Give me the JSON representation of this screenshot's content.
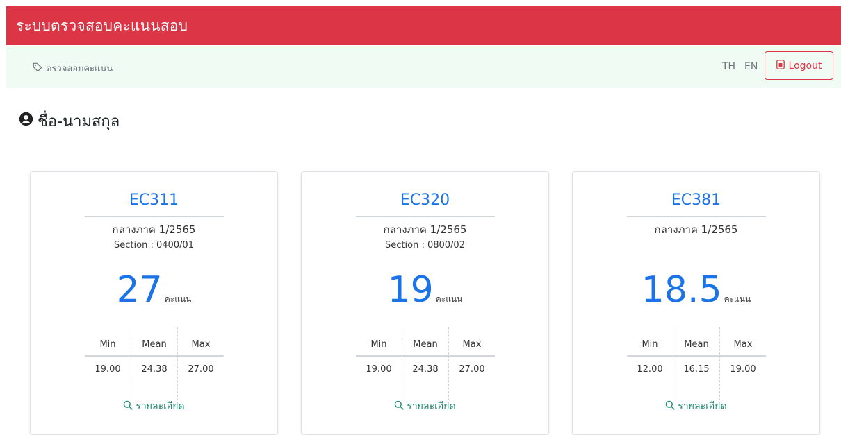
{
  "header": {
    "title": "ระบบตรวจสอบคะแนนสอบ"
  },
  "nav": {
    "breadcrumb": "ตรวจสอบคะแนน",
    "lang_th": "TH",
    "lang_en": "EN",
    "logout": "Logout"
  },
  "user": {
    "name": "ชื่อ-นามสกุล"
  },
  "colors": {
    "brand": "#dc3545",
    "accent": "#1a73e8",
    "link": "#1e8a6e",
    "subbar": "#f0fbf3"
  },
  "cards": [
    {
      "code": "EC311",
      "term": "กลางภาค 1/2565",
      "section": "Section : 0400/01",
      "score": "27",
      "unit": "คะแนน",
      "min_label": "Min",
      "mean_label": "Mean",
      "max_label": "Max",
      "min": "19.00",
      "mean": "24.38",
      "max": "27.00",
      "detail": "รายละเอียด"
    },
    {
      "code": "EC320",
      "term": "กลางภาค 1/2565",
      "section": "Section : 0800/02",
      "score": "19",
      "unit": "คะแนน",
      "min_label": "Min",
      "mean_label": "Mean",
      "max_label": "Max",
      "min": "19.00",
      "mean": "24.38",
      "max": "27.00",
      "detail": "รายละเอียด"
    },
    {
      "code": "EC381",
      "term": "กลางภาค 1/2565",
      "score": "18.5",
      "unit": "คะแนน",
      "min_label": "Min",
      "mean_label": "Mean",
      "max_label": "Max",
      "min": "12.00",
      "mean": "16.15",
      "max": "19.00",
      "detail": "รายละเอียด"
    }
  ]
}
